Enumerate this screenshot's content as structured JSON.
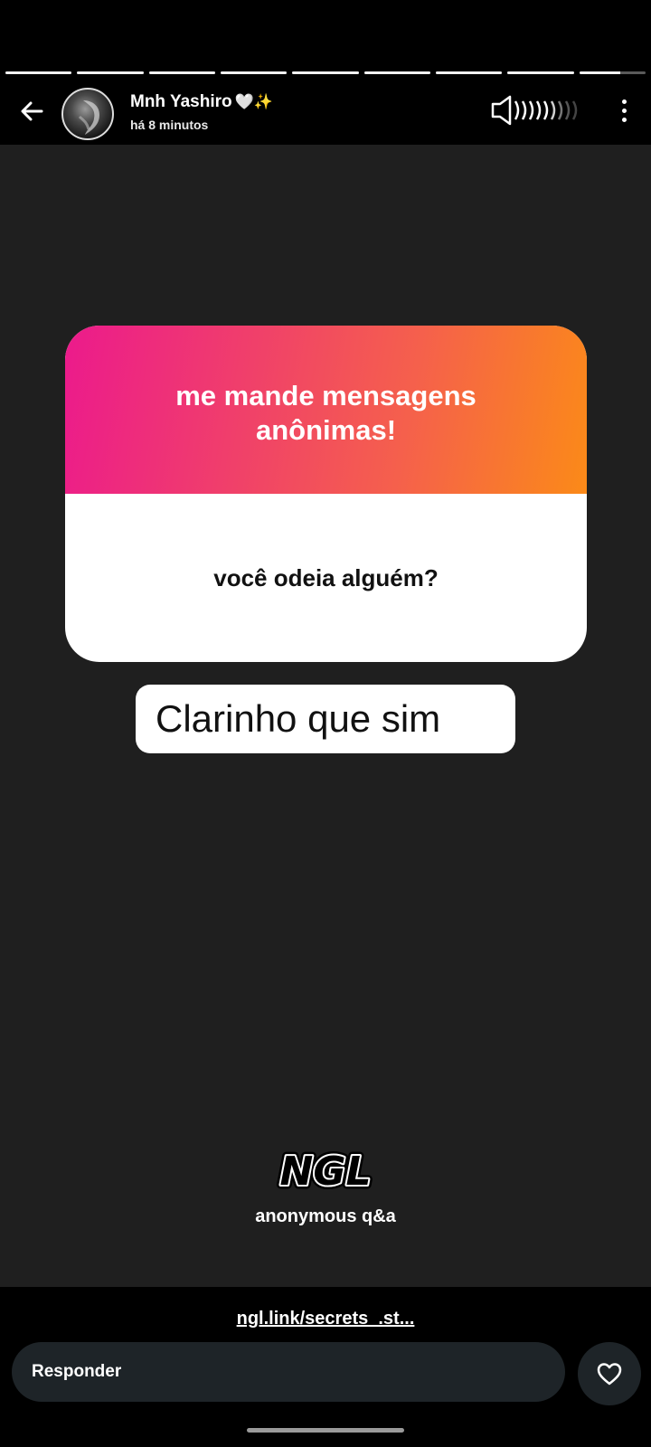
{
  "story": {
    "segment_count": 9,
    "current_segment_progress": 0.62,
    "completed_segments": 8
  },
  "header": {
    "username": "Mnh Yashiro",
    "username_emoji": "🤍✨",
    "timestamp": "há 8 minutos",
    "icons": [
      "back-arrow-icon",
      "volume-icon",
      "more-vertical-icon"
    ]
  },
  "card": {
    "title": "me mande mensagens anônimas!",
    "question": "você odeia alguém?",
    "gradient": [
      "#ec1a8c",
      "#fb8a18"
    ]
  },
  "answer": {
    "text": "Clarinho que sim"
  },
  "ngl": {
    "logo_text": "NGL",
    "subtitle": "anonymous q&a"
  },
  "footer": {
    "link": "ngl.link/secrets_.st...",
    "reply_placeholder": "Responder",
    "heart_icon": "heart-icon"
  }
}
